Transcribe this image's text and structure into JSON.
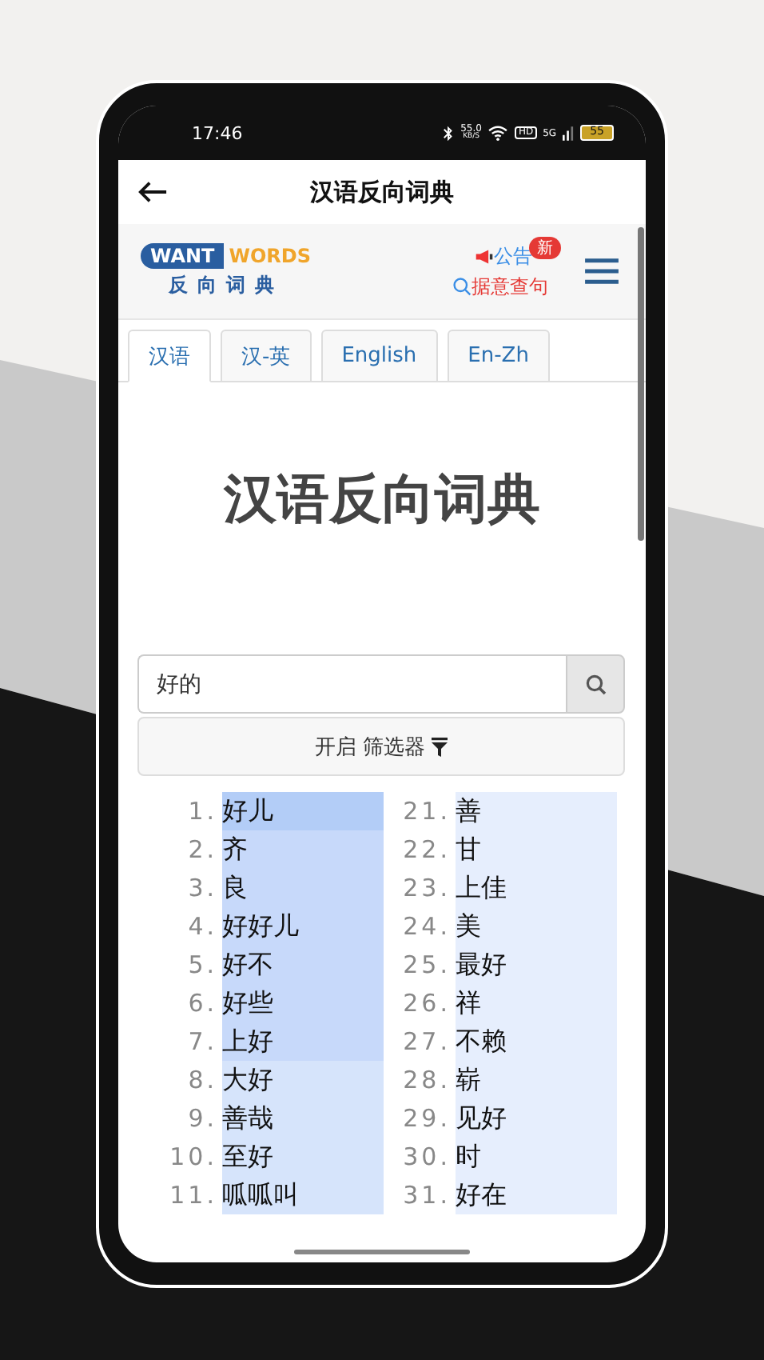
{
  "status_bar": {
    "time": "17:46",
    "net_speed": "55.0",
    "net_unit": "KB/S",
    "hd": "HD",
    "network": "5G",
    "battery": "55"
  },
  "app_bar": {
    "title": "汉语反向词典"
  },
  "site_header": {
    "logo_left": "WANT",
    "logo_right": "WORDS",
    "logo_sub": "反向词典",
    "notice": "公告",
    "notice_badge": "新",
    "query_link": "据意查句"
  },
  "tabs": [
    {
      "label": "汉语",
      "selected": true
    },
    {
      "label": "汉-英",
      "selected": false
    },
    {
      "label": "English",
      "selected": false
    },
    {
      "label": "En-Zh",
      "selected": false
    }
  ],
  "heading": "汉语反向词典",
  "search": {
    "value": "好的"
  },
  "filter_button": "开启 筛选器",
  "result_columns": [
    {
      "items": [
        {
          "number": "1.",
          "word": "好儿",
          "color": "#b3cdf7"
        },
        {
          "number": "2.",
          "word": "齐",
          "color": "#c7d9fa"
        },
        {
          "number": "3.",
          "word": "良",
          "color": "#c7d9fa"
        },
        {
          "number": "4.",
          "word": "好好儿",
          "color": "#c7d9fa"
        },
        {
          "number": "5.",
          "word": "好不",
          "color": "#c7d9fa"
        },
        {
          "number": "6.",
          "word": "好些",
          "color": "#c7d9fa"
        },
        {
          "number": "7.",
          "word": "上好",
          "color": "#c7d9fa"
        },
        {
          "number": "8.",
          "word": "大好",
          "color": "#d6e4fb"
        },
        {
          "number": "9.",
          "word": "善哉",
          "color": "#d6e4fb"
        },
        {
          "number": "10.",
          "word": "至好",
          "color": "#d6e4fb"
        },
        {
          "number": "11.",
          "word": "呱呱叫",
          "color": "#d6e4fb"
        }
      ]
    },
    {
      "items": [
        {
          "number": "21.",
          "word": "善",
          "color": "#e6eefd"
        },
        {
          "number": "22.",
          "word": "甘",
          "color": "#e6eefd"
        },
        {
          "number": "23.",
          "word": "上佳",
          "color": "#e6eefd"
        },
        {
          "number": "24.",
          "word": "美",
          "color": "#e6eefd"
        },
        {
          "number": "25.",
          "word": "最好",
          "color": "#e6eefd"
        },
        {
          "number": "26.",
          "word": "祥",
          "color": "#e6eefd"
        },
        {
          "number": "27.",
          "word": "不赖",
          "color": "#e6eefd"
        },
        {
          "number": "28.",
          "word": "崭",
          "color": "#e6eefd"
        },
        {
          "number": "29.",
          "word": "见好",
          "color": "#e6eefd"
        },
        {
          "number": "30.",
          "word": "时",
          "color": "#e6eefd"
        },
        {
          "number": "31.",
          "word": "好在",
          "color": "#e6eefd"
        }
      ]
    }
  ]
}
